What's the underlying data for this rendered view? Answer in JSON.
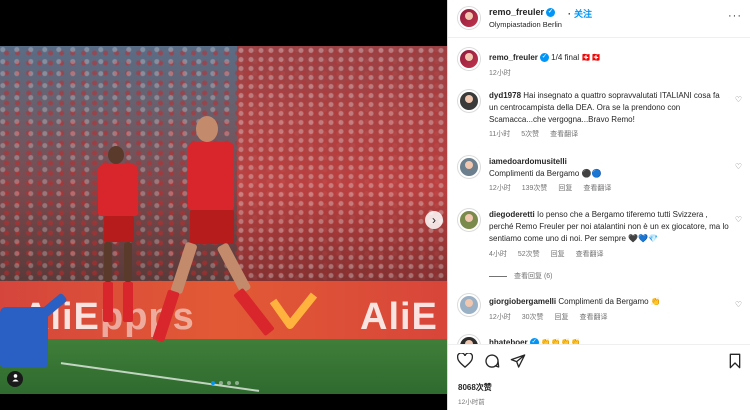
{
  "post": {
    "username": "remo_freuler",
    "follow_label": "关注",
    "location": "Olympiastadion Berlin",
    "caption": "1/4 final 🇨🇭🇨🇭",
    "caption_time": "12小时",
    "likes": "8068次赞",
    "posted": "12小时前",
    "carousel": {
      "slides": 4,
      "active": 1
    },
    "ad_text_left": "AliE",
    "ad_text_right": "AliE",
    "ad_text_mid": "ppps"
  },
  "comments": [
    {
      "user": "dyd1978",
      "text": "Hai insegnato a quattro sopravvalutati ITALIANI cosa fa un centrocampista della DEA. Ora se la prendono con Scamacca...che vergogna...Bravo Remo!",
      "time": "11小时",
      "likes": "5次赞",
      "translate": "查看翻译",
      "avatar_color": "#3a3a3a"
    },
    {
      "user": "iamedoardomusitelli",
      "text": "Complimenti da Bergamo ⚫🔵",
      "time": "12小时",
      "likes": "139次赞",
      "reply": "回复",
      "translate": "查看翻译",
      "avatar_color": "#6b7f8e"
    },
    {
      "user": "diegoderetti",
      "text": "Io penso che a Bergamo tiferemo tutti Svizzera , perché Remo Freuler per noi atalantini non è un ex giocatore, ma lo sentiamo come uno di noi. Per sempre 🖤💙💎",
      "time": "4小时",
      "likes": "52次赞",
      "reply": "回复",
      "translate": "查看翻译",
      "view_replies": "查看回复 (6)",
      "avatar_color": "#7a8a4a"
    },
    {
      "user": "giorgiobergamelli",
      "text": "Complimenti da Bergamo 👏",
      "time": "12小时",
      "likes": "30次赞",
      "reply": "回复",
      "translate": "查看翻译",
      "avatar_color": "#9ab0c4"
    },
    {
      "user": "hhateboer",
      "text": "👏👏👏👏",
      "avatar_color": "#2c2c2c"
    }
  ],
  "icons": {
    "heart": "♡",
    "comment": "💬",
    "share": "➤",
    "bookmark": "🔖",
    "more": "···",
    "next": "›",
    "tag": "👤"
  },
  "colors": {
    "accent": "#0095f6",
    "muted": "#737373"
  }
}
